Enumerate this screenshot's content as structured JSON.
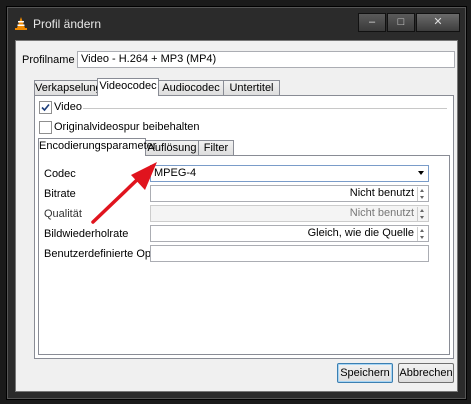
{
  "window": {
    "title": "Profil ändern",
    "controls": {
      "minimize": "–",
      "maximize": "□",
      "close": "✕"
    }
  },
  "profile": {
    "label": "Profilname",
    "value": "Video - H.264 + MP3 (MP4)"
  },
  "tabs": [
    {
      "label": "Verkapselung"
    },
    {
      "label": "Videocodec"
    },
    {
      "label": "Audiocodec"
    },
    {
      "label": "Untertitel"
    }
  ],
  "video": {
    "label": "Video",
    "checked": true
  },
  "keep_original": {
    "label": "Originalvideospur beibehalten",
    "checked": false
  },
  "subtabs": [
    {
      "label": "Encodierungsparameter"
    },
    {
      "label": "Auflösung"
    },
    {
      "label": "Filter"
    }
  ],
  "fields": {
    "codec": {
      "label": "Codec",
      "value": "MPEG-4"
    },
    "bitrate": {
      "label": "Bitrate",
      "value": "Nicht benutzt"
    },
    "quality": {
      "label": "Qualität",
      "value": "Nicht benutzt"
    },
    "framerate": {
      "label": "Bildwiederholrate",
      "value": "Gleich, wie die Quelle"
    },
    "custom": {
      "label": "Benutzerdefinierte Optionen",
      "value": ""
    }
  },
  "buttons": {
    "save": "Speichern",
    "cancel": "Abbrechen"
  },
  "colors": {
    "arrow": "#e0141e",
    "default_button": "#3c7fb1"
  }
}
